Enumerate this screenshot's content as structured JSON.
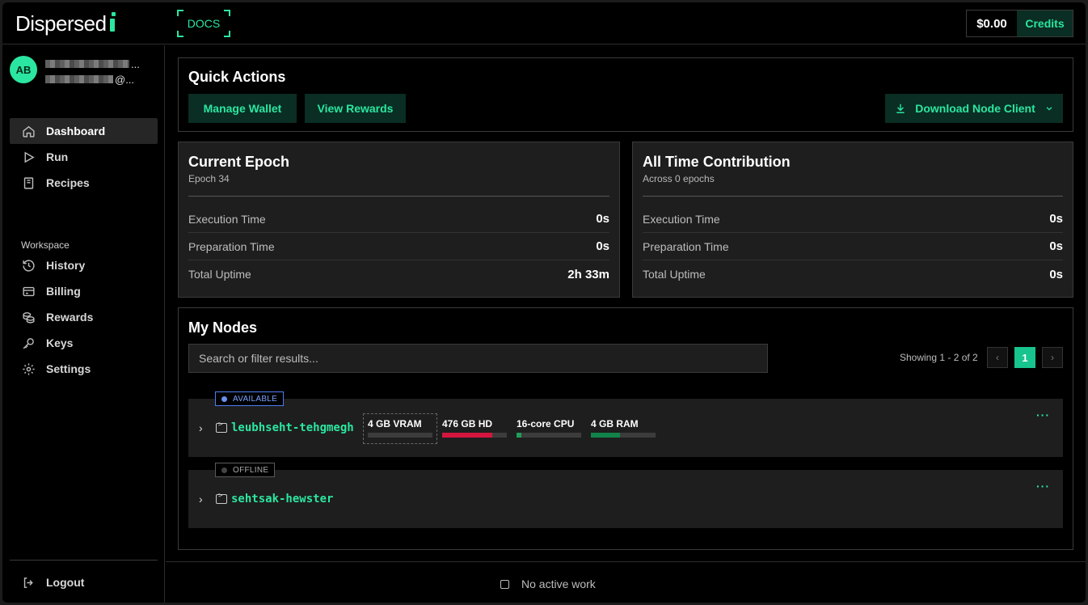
{
  "app": {
    "logo_text": "Dispersed",
    "docs_label": "DOCS"
  },
  "header": {
    "balance": "$0.00",
    "credits_label": "Credits"
  },
  "user": {
    "initials": "AB",
    "name_suffix": "...",
    "email_suffix": "@..."
  },
  "sidebar": {
    "items": [
      {
        "label": "Dashboard",
        "icon": "home-icon"
      },
      {
        "label": "Run",
        "icon": "play-icon"
      },
      {
        "label": "Recipes",
        "icon": "book-icon"
      }
    ],
    "section_label": "Workspace",
    "workspace_items": [
      {
        "label": "History",
        "icon": "history-icon"
      },
      {
        "label": "Billing",
        "icon": "card-icon"
      },
      {
        "label": "Rewards",
        "icon": "coins-icon"
      },
      {
        "label": "Keys",
        "icon": "key-icon"
      },
      {
        "label": "Settings",
        "icon": "gear-icon"
      }
    ],
    "logout_label": "Logout"
  },
  "quick_actions": {
    "title": "Quick Actions",
    "manage_wallet": "Manage Wallet",
    "view_rewards": "View Rewards",
    "download_node": "Download Node Client"
  },
  "current_epoch": {
    "title": "Current Epoch",
    "subtitle": "Epoch 34",
    "rows": [
      {
        "label": "Execution Time",
        "value": "0s"
      },
      {
        "label": "Preparation Time",
        "value": "0s"
      },
      {
        "label": "Total Uptime",
        "value": "2h 33m"
      }
    ]
  },
  "all_time": {
    "title": "All Time Contribution",
    "subtitle": "Across 0 epochs",
    "rows": [
      {
        "label": "Execution Time",
        "value": "0s"
      },
      {
        "label": "Preparation Time",
        "value": "0s"
      },
      {
        "label": "Total Uptime",
        "value": "0s"
      }
    ]
  },
  "nodes": {
    "title": "My Nodes",
    "search_placeholder": "Search or filter results...",
    "showing": "Showing 1 - 2 of 2",
    "prev": "‹",
    "current_page": "1",
    "next": "›",
    "list": [
      {
        "status": "AVAILABLE",
        "name": "leubhseht-tehgmegh",
        "resources": [
          {
            "label": "4 GB VRAM",
            "fraction": 0.0,
            "color": "#3c3c3c"
          },
          {
            "label": "476 GB HD",
            "fraction": 0.78,
            "color": "#d4163f"
          },
          {
            "label": "16-core CPU",
            "fraction": 0.07,
            "color": "#1f9e5a"
          },
          {
            "label": "4 GB RAM",
            "fraction": 0.45,
            "color": "#12834a"
          }
        ]
      },
      {
        "status": "OFFLINE",
        "name": "sehtsak-hewster"
      }
    ],
    "menu_glyph": "···"
  },
  "footer": {
    "status": "No active work"
  },
  "colors": {
    "accent": "#2be6a0",
    "button_bg": "#0a2e24",
    "available": "#4f7df2"
  }
}
